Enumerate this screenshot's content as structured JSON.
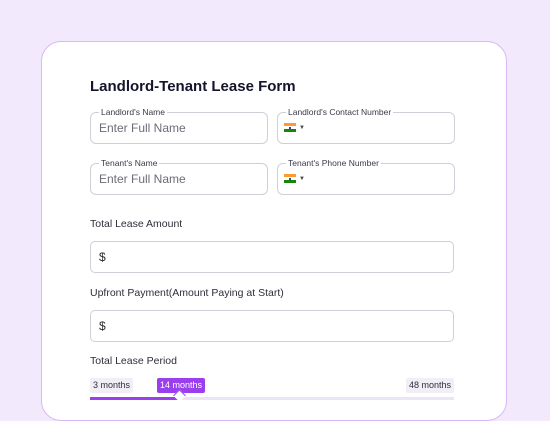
{
  "form": {
    "title": "Landlord-Tenant Lease Form",
    "landlord_name": {
      "label": "Landlord's Name",
      "placeholder": "Enter Full Name",
      "value": ""
    },
    "landlord_contact": {
      "label": "Landlord's Contact Number",
      "country": "India",
      "flag_icon": "india-flag-icon"
    },
    "tenant_name": {
      "label": "Tenant's Name",
      "placeholder": "Enter Full Name",
      "value": ""
    },
    "tenant_phone": {
      "label": "Tenant's Phone Number",
      "country": "India",
      "flag_icon": "india-flag-icon"
    },
    "total_lease": {
      "label": "Total Lease Amount",
      "currency": "$",
      "value": ""
    },
    "upfront": {
      "label": "Upfront Payment(Amount Paying at Start)",
      "currency": "$",
      "value": ""
    },
    "lease_period": {
      "label": "Total Lease Period",
      "min_label": "3 months",
      "max_label": "48 months",
      "current_label": "14 months",
      "min": 3,
      "max": 48,
      "value": 14
    }
  },
  "colors": {
    "accent": "#9a3fee",
    "page_bg": "#f3e9fd",
    "card_border": "#d8b8f5"
  }
}
